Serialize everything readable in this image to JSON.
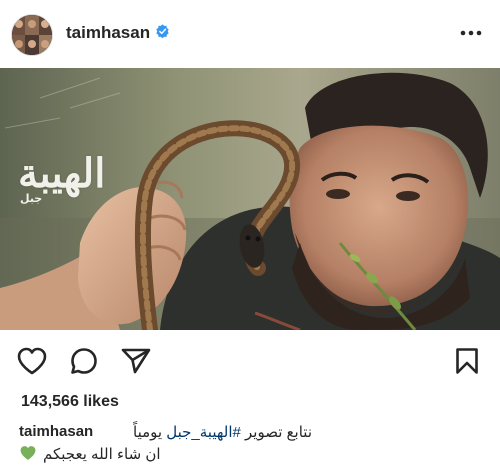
{
  "post": {
    "username": "taimhasan",
    "verified": true,
    "more_icon": "more-horizontal-icon"
  },
  "image": {
    "logo_title": "الهيبة",
    "logo_subtitle": "جبل"
  },
  "actions": {
    "like_icon": "heart-icon",
    "comment_icon": "comment-icon",
    "share_icon": "send-icon",
    "save_icon": "bookmark-icon"
  },
  "likes": {
    "text": "143,566 likes"
  },
  "caption": {
    "username": "taimhasan",
    "line1_prefix": "نتابع  تصوير ",
    "hashtag": "#الهيبة_جبل",
    "line1_suffix": " يومياً",
    "line2": "ان شاء الله يعجبكم",
    "emoji": "green-heart-icon"
  },
  "colors": {
    "text": "#262626",
    "hashtag": "#00376b",
    "verified": "#3897f0",
    "emoji_heart": "#78b159"
  }
}
